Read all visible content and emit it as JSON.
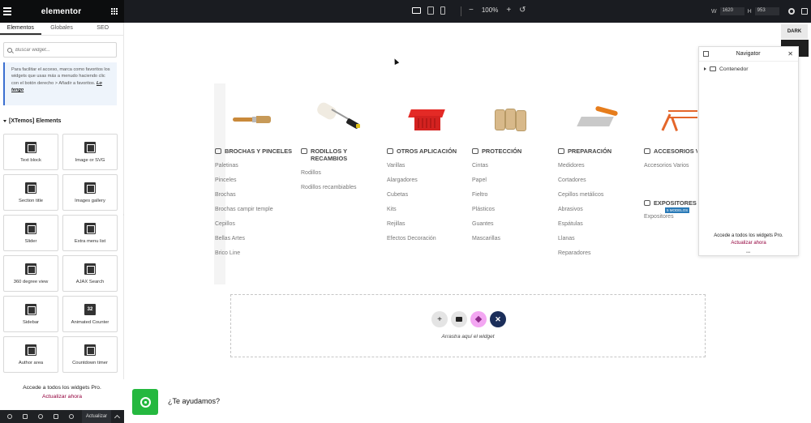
{
  "app": {
    "logo": "elementor",
    "zoom": "100%",
    "width_label": "W",
    "width_value": "1620",
    "height_label": "H",
    "height_value": "953"
  },
  "sidebar": {
    "tabs": [
      "Elementos",
      "Globales",
      "SEO"
    ],
    "active_tab": "Elementos",
    "search_placeholder": "Buscar widget...",
    "tip_text": "Para facilitar el acceso, marca como favoritos los widgets que usas más a menudo haciendo clic con el botón derecho > Añadir a favoritos.",
    "tip_link": "Lo tengo",
    "category": "[XTemos] Elements",
    "widgets": [
      {
        "label": "Text block",
        "icon": "text-block-icon"
      },
      {
        "label": "Image or SVG",
        "icon": "image-icon"
      },
      {
        "label": "Section title",
        "icon": "section-title-icon"
      },
      {
        "label": "Images gallery",
        "icon": "gallery-icon"
      },
      {
        "label": "Slider",
        "icon": "slider-icon"
      },
      {
        "label": "Extra menu list",
        "icon": "menu-list-icon"
      },
      {
        "label": "360 degree view",
        "icon": "360-view-icon"
      },
      {
        "label": "AJAX Search",
        "icon": "search-icon"
      },
      {
        "label": "Sidebar",
        "icon": "sidebar-icon"
      },
      {
        "label": "Animated Counter",
        "icon": "counter-icon",
        "icon_text": "32"
      },
      {
        "label": "Author area",
        "icon": "author-icon"
      },
      {
        "label": "Countdown timer",
        "icon": "timer-icon"
      }
    ],
    "pro_text": "Accede a todos los widgets Pro.",
    "pro_link": "Actualizar ahora",
    "bottom_update": "Actualizar"
  },
  "canvas": {
    "dark_label": "DARK",
    "columns": [
      {
        "heading": "BROCHAS Y PINCELES",
        "items": [
          "Paletinas",
          "Pinceles",
          "Brochas",
          "Brochas campir temple",
          "Cepillos",
          "Bellas Artes",
          "Brico Line"
        ]
      },
      {
        "heading": "RODILLOS Y RECAMBIOS",
        "items": [
          "Rodillos",
          "Rodillos recambiables"
        ]
      },
      {
        "heading": "OTROS APLICACIÓN",
        "items": [
          "Varillas",
          "Alargadores",
          "Cubetas",
          "Kits",
          "Rejillas",
          "Efectos Decoración"
        ]
      },
      {
        "heading": "PROTECCIÓN",
        "items": [
          "Cintas",
          "Papel",
          "Fieltro",
          "Plásticos",
          "Guantes",
          "Mascarillas"
        ]
      },
      {
        "heading": "PREPARACIÓN",
        "items": [
          "Medidores",
          "Cortadores",
          "Cepillos metálicos",
          "Abrasivos",
          "Espátulas",
          "Llanas",
          "Reparadores"
        ]
      },
      {
        "heading": "ACCESORIOS VA",
        "items": [
          "Accesorios Varios"
        ]
      }
    ],
    "expositores_heading": "EXPOSITORES",
    "expositores_badge": "5 MODELOS",
    "expositores_item": "Expositores",
    "drop_text": "Arrastra aquí el widget",
    "help_text": "¿Te ayudamos?"
  },
  "navigator": {
    "title": "Navigator",
    "item": "Contenedor",
    "pro_text": "Accede a todos los widgets Pro.",
    "pro_link": "Actualizar ahora"
  }
}
